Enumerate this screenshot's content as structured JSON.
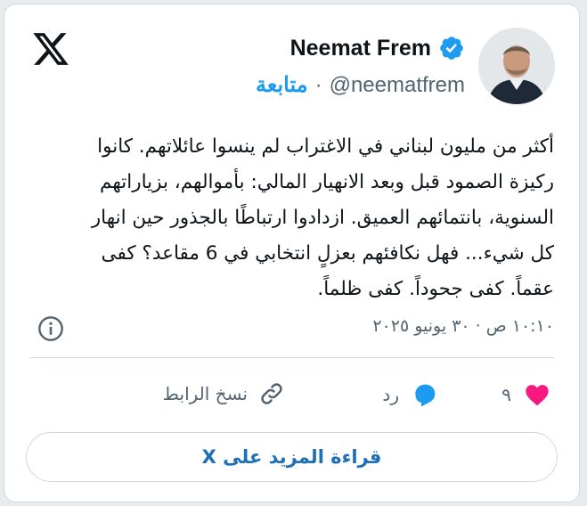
{
  "header": {
    "display_name": "Neemat Frem",
    "handle": "@neematfrem",
    "separator": "·",
    "follow_label": "متابعة",
    "verified": true
  },
  "tweet": {
    "lines": [
      "أكثر من مليون لبناني في الاغتراب لم ينسوا عائلاتهم. كانوا",
      "ركيزة الصمود قبل وبعد الانهيار المالي: بأموالهم، بزياراتهم",
      "السنوية، بانتمائهم العميق. ازدادوا ارتباطًا بالجذور حين انهار",
      "كل شيء... فهل نكافئهم بعزلٍ انتخابي في 6 مقاعد؟ كفى",
      "عقماً. كفى جحوداً. كفى ظلماً."
    ],
    "timestamp": "١٠:١٠ ص · ٣٠ يونيو ٢٠٢٥"
  },
  "actions": {
    "like_count": "٩",
    "reply_label": "رد",
    "copy_link_label": "نسخ الرابط"
  },
  "footer": {
    "read_more_label": "قراءة المزيد على X"
  },
  "colors": {
    "accent": "#1d9bf0",
    "heart": "#f91880",
    "text": "#0f1419",
    "secondary": "#536471"
  }
}
